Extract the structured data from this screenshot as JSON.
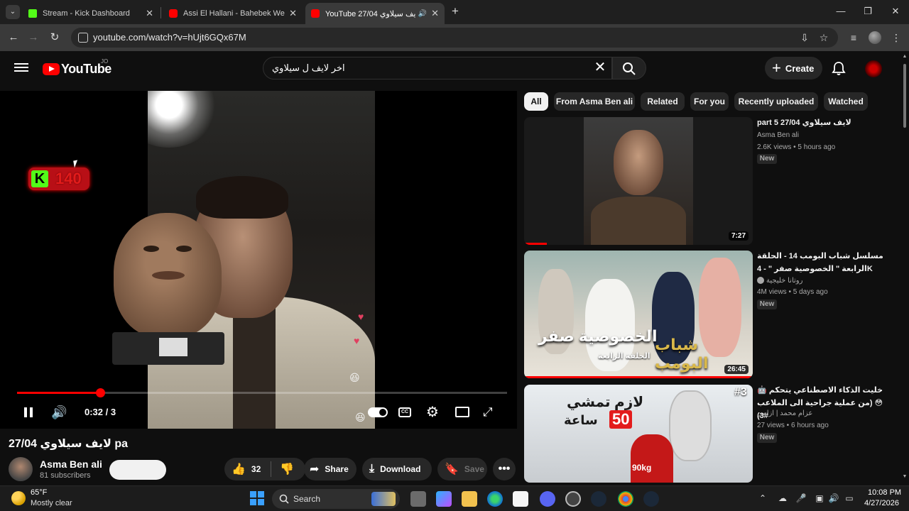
{
  "browser": {
    "tabs": [
      {
        "title": "Stream - Kick Dashboard",
        "favicon_color": "#53fc18"
      },
      {
        "title": "Assi El Hallani - Bahebek We Bg",
        "favicon_color": "#ff0000"
      },
      {
        "title": "YouTube 27/04 لايف سيلاوي",
        "favicon_color": "#ff0000",
        "active": true
      }
    ],
    "url": "youtube.com/watch?v=hUjt6GQx67M"
  },
  "masthead": {
    "logo_text": "YouTube",
    "region": "JO",
    "search_query": "اخر لايف ل سيلاوي",
    "create_label": "Create"
  },
  "player": {
    "kick_overlay_count": "140",
    "time_text": "0:32 / 3",
    "progress_fraction": 0.17
  },
  "video": {
    "title": "27/04 لايف سيلاوي pa",
    "channel": "Asma Ben ali",
    "subscribers": "81 subscribers",
    "likes": "32",
    "share_label": "Share",
    "download_label": "Download",
    "save_label": "Save"
  },
  "chips": [
    "All",
    "From Asma Ben ali",
    "Related",
    "For you",
    "Recently uploaded",
    "Watched"
  ],
  "recommendations": [
    {
      "title": "part 5 27/04 لايف سيلاوي",
      "channel": "Asma Ben ali",
      "meta": "2.6K views • 5 hours ago",
      "badge": "New",
      "duration": "7:27",
      "watched_fraction": 0.1
    },
    {
      "title": "مسلسل شباب البومب 14 - الحلقة الرابعة \" الخصوصية صفر \" - 4K",
      "channel": "روتانا خليجية",
      "meta": "4M views • 5 days ago",
      "badge": "New",
      "duration": "26:45",
      "thumb_text_main": "الخصوصية صفر",
      "thumb_text_sub": "الحلقة الرابعة",
      "thumb_logo": "شباب البومب",
      "watched_fraction": 1.0
    },
    {
      "title": "خليت الذكاء الاصطناعي يتحكم 🤖 😳 (من عملية جراحية الى الملاعب #3)",
      "channel": "عزام محمد | ازامي",
      "meta": "27 views • 6 hours ago",
      "badge": "New",
      "thumb_text_main": "لازم تمشي",
      "thumb_text_num": "50",
      "thumb_text_unit": "ساعة",
      "thumb_text_weight": "90kg",
      "thumb_episode": "#3"
    }
  ],
  "taskbar": {
    "temperature": "65°F",
    "condition": "Mostly clear",
    "search_label": "Search",
    "time": "10:08 PM",
    "date": "4/27/2026"
  },
  "colors": {
    "accent_red": "#ff0000",
    "kick_green": "#53fc18",
    "background": "#0f0f0f"
  }
}
